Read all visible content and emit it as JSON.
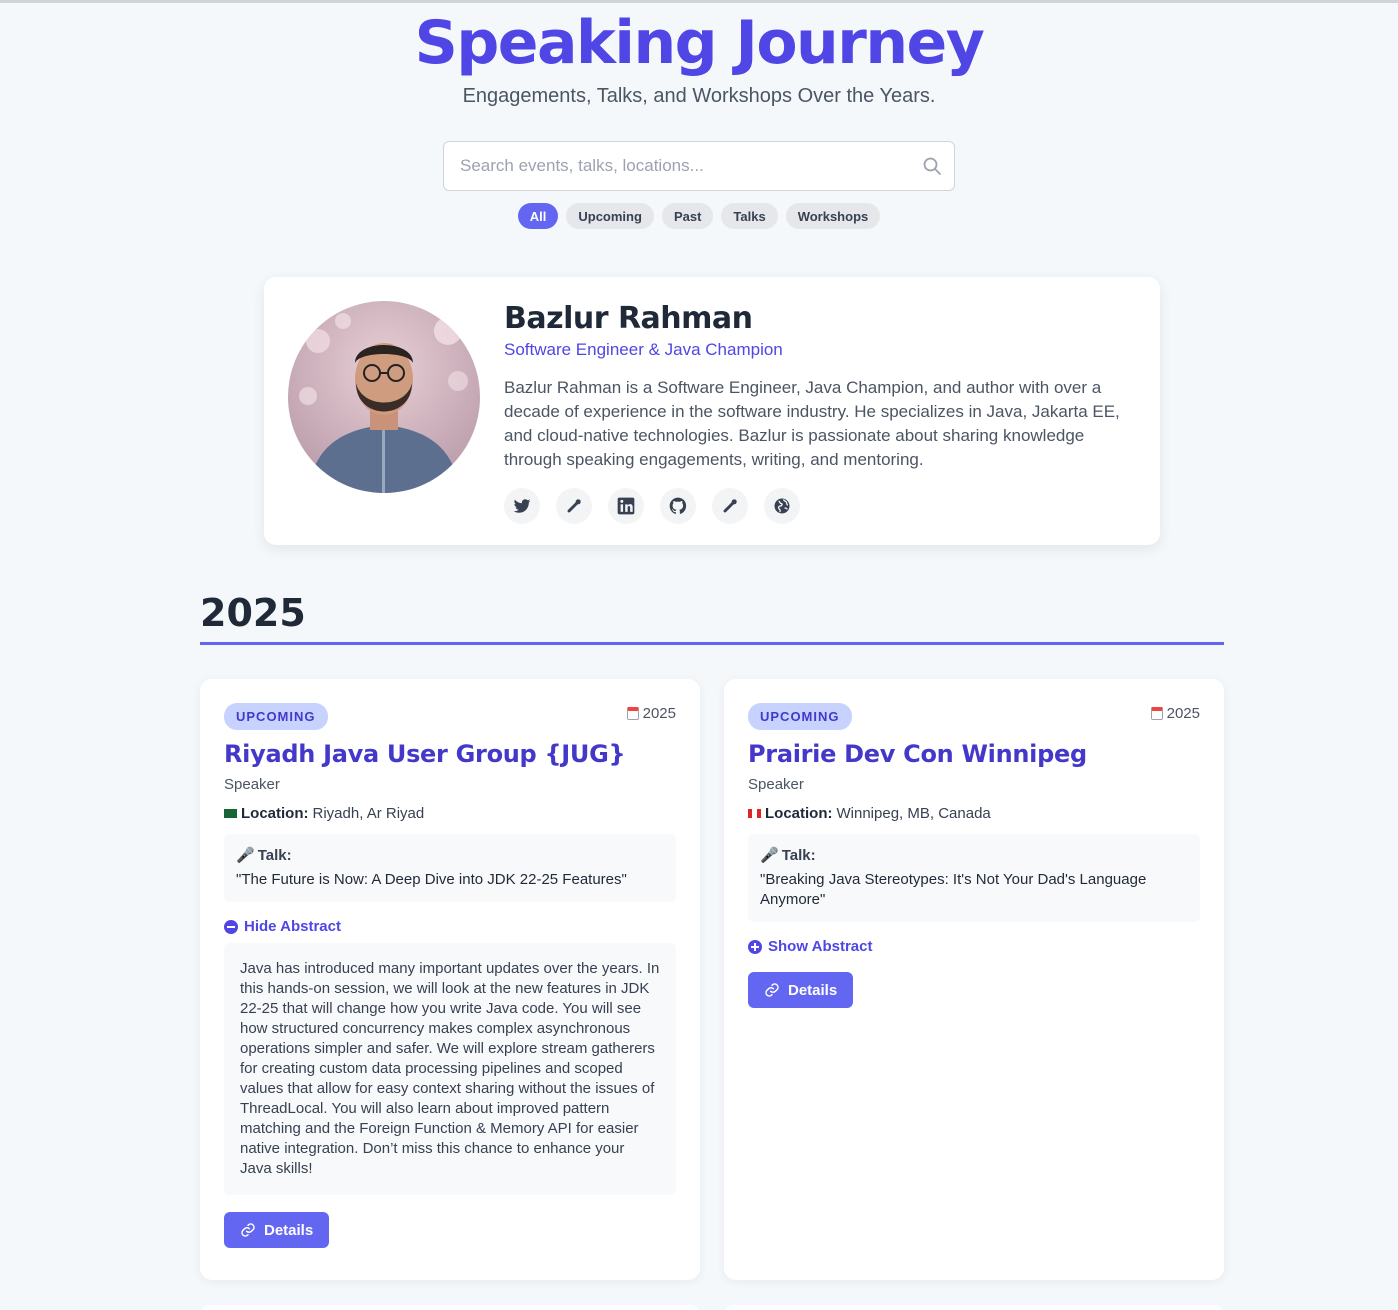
{
  "header": {
    "title": "Speaking Journey",
    "subtitle": "Engagements, Talks, and Workshops Over the Years."
  },
  "search": {
    "placeholder": "Search events, talks, locations..."
  },
  "filters": [
    {
      "label": "All",
      "active": true
    },
    {
      "label": "Upcoming",
      "active": false
    },
    {
      "label": "Past",
      "active": false
    },
    {
      "label": "Talks",
      "active": false
    },
    {
      "label": "Workshops",
      "active": false
    }
  ],
  "profile": {
    "name": "Bazlur Rahman",
    "role": "Software Engineer & Java Champion",
    "bio": "Bazlur Rahman is a Software Engineer, Java Champion, and author with over a decade of experience in the software industry. He specializes in Java, Jakarta EE, and cloud-native technologies. Bazlur is passionate about sharing knowledge through speaking engagements, writing, and mentoring.",
    "socials": [
      "twitter-icon",
      "link-icon",
      "linkedin-icon",
      "github-icon",
      "link-icon",
      "globe-icon"
    ]
  },
  "year_section": {
    "year": "2025"
  },
  "events": [
    {
      "badge": "UPCOMING",
      "date": "2025",
      "title": "Riyadh Java User Group {JUG}",
      "role": "Speaker",
      "location_label": "Location:",
      "location": "Riyadh, Ar Riyad",
      "talk_label": "Talk:",
      "talk_title": "\"The Future is Now: A Deep Dive into JDK 22-25 Features\"",
      "toggle_label": "Hide Abstract",
      "abstract": "Java has introduced many important updates over the years. In this hands-on session, we will look at the new features in JDK 22-25 that will change how you write Java code. You will see how structured concurrency makes complex asynchronous operations simpler and safer. We will explore stream gatherers for creating custom data processing pipelines and scoped values that allow for easy context sharing without the issues of ThreadLocal. You will also learn about improved pattern matching and the Foreign Function & Memory API for easier native integration. Don’t miss this chance to enhance your Java skills!",
      "details_label": "Details"
    },
    {
      "badge": "UPCOMING",
      "date": "2025",
      "title": "Prairie Dev Con Winnipeg",
      "role": "Speaker",
      "location_label": "Location:",
      "location": "Winnipeg, MB, Canada",
      "talk_label": "Talk:",
      "talk_title": "\"Breaking Java Stereotypes: It's Not Your Dad's Language Anymore\"",
      "toggle_label": "Show Abstract",
      "details_label": "Details"
    }
  ],
  "colors": {
    "accent": "#6366f1",
    "title": "#4f46e5",
    "badge_bg": "#c7d2fe"
  }
}
